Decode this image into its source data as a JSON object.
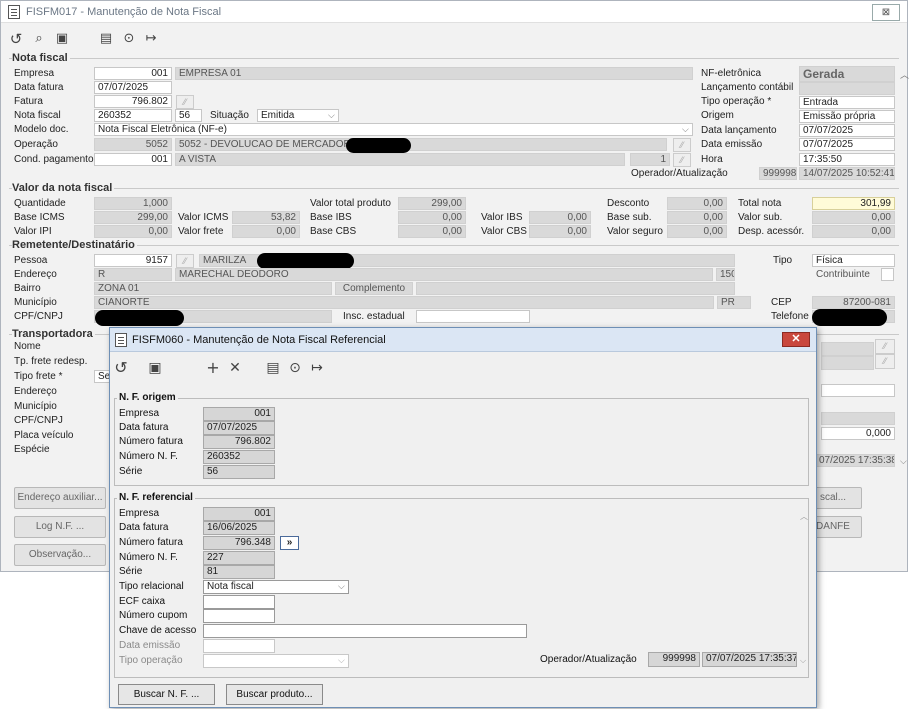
{
  "main_window": {
    "title": "FISFM017 - Manutenção de Nota Fiscal",
    "toolbar": {
      "refresh": "↺",
      "search": "🔍",
      "save": "🖫",
      "calendar": "📅",
      "help": "?",
      "exit": "↦"
    },
    "nota_fiscal": {
      "section": "Nota fiscal",
      "empresa_label": "Empresa",
      "empresa_code": "001",
      "empresa_name": "EMPRESA 01",
      "data_fatura_label": "Data fatura",
      "data_fatura": "07/07/2025",
      "fatura_label": "Fatura",
      "fatura": "796.802",
      "nota_fiscal_label": "Nota fiscal",
      "nota_fiscal": "260352",
      "serie": "56",
      "situacao_label": "Situação",
      "situacao": "Emitida",
      "modelo_label": "Modelo doc.",
      "modelo": "Nota Fiscal Eletrônica (NF-e)",
      "operacao_label": "Operação",
      "operacao_code": "5052",
      "operacao_desc": "5052 - DEVOLUCAO DE MERCADORIA",
      "cond_label": "Cond. pagamento",
      "cond_code": "001",
      "cond_desc": "A VISTA",
      "cond_parcelas": "1",
      "nfe_label": "NF-eletrônica",
      "nfe_status": "Gerada",
      "lanc_contabil_label": "Lançamento contábil",
      "tipo_op_label": "Tipo operação *",
      "tipo_op": "Entrada",
      "origem_label": "Origem",
      "origem": "Emissão própria",
      "data_lanc_label": "Data lançamento",
      "data_lanc": "07/07/2025",
      "data_emissao_label": "Data emissão",
      "data_emissao": "07/07/2025",
      "hora_label": "Hora",
      "hora": "17:35:50",
      "operador_label": "Operador/Atualização",
      "operador": "999998",
      "atualizacao": "14/07/2025 10:52:41"
    },
    "valor": {
      "section": "Valor da nota fiscal",
      "quantidade_label": "Quantidade",
      "quantidade": "1,000",
      "base_icms_label": "Base ICMS",
      "base_icms": "299,00",
      "valor_ipi_label": "Valor IPI",
      "valor_ipi": "0,00",
      "valor_icms_label": "Valor ICMS",
      "valor_icms": "53,82",
      "valor_frete_label": "Valor frete",
      "valor_frete": "0,00",
      "total_prod_label": "Valor total produto",
      "total_prod": "299,00",
      "base_ibs_label": "Base IBS",
      "base_ibs": "0,00",
      "base_cbs_label": "Base CBS",
      "base_cbs": "0,00",
      "valor_ibs_label": "Valor IBS",
      "valor_ibs": "0,00",
      "valor_cbs_label": "Valor CBS",
      "valor_cbs": "0,00",
      "desconto_label": "Desconto",
      "desconto": "0,00",
      "base_sub_label": "Base sub.",
      "base_sub": "0,00",
      "valor_seguro_label": "Valor seguro",
      "valor_seguro": "0,00",
      "total_nota_label": "Total nota",
      "total_nota": "301,99",
      "valor_sub_label": "Valor sub.",
      "valor_sub": "0,00",
      "desp_label": "Desp. acessór.",
      "desp": "0,00"
    },
    "remetente": {
      "section": "Remetente/Destinatário",
      "pessoa_label": "Pessoa",
      "pessoa_code": "9157",
      "pessoa_name": "MARILZA",
      "endereco_label": "Endereço",
      "endereco_tipo": "R",
      "endereco": "MARECHAL DEODORO",
      "numero": "150",
      "bairro_label": "Bairro",
      "bairro": "ZONA 01",
      "complemento_label": "Complemento",
      "municipio_label": "Município",
      "municipio": "CIANORTE",
      "uf": "PR",
      "cpf_label": "CPF/CNPJ",
      "insc_label": "Insc. estadual",
      "tipo_label": "Tipo",
      "tipo": "Física",
      "contribuinte_label": "Contribuinte",
      "cep_label": "CEP",
      "cep": "87200-081",
      "telefone_label": "Telefone"
    },
    "transportadora": {
      "section": "Transportadora",
      "nome_label": "Nome",
      "tp_frete_label": "Tp. frete redesp.",
      "tipo_frete_label": "Tipo frete *",
      "tipo_frete": "Se",
      "endereco_label": "Endereço",
      "municipio_label": "Município",
      "cpf_label": "CPF/CNPJ",
      "placa_label": "Placa veículo",
      "especie_label": "Espécie",
      "peso": "0,000",
      "atualizacao": "07/2025 17:35:38"
    },
    "buttons": {
      "endereco_aux": "Endereço auxiliar...",
      "log": "Log N.F. ...",
      "observacao": "Observação...",
      "fiscal": "scal...",
      "danfe": "DANFE"
    }
  },
  "dialog": {
    "title": "FISFM060 - Manutenção de Nota Fiscal Referencial",
    "close": "✕",
    "toolbar": {
      "refresh": "↺",
      "save": "🖫",
      "add": "+",
      "remove": "✕",
      "calendar": "📅",
      "help": "?",
      "exit": "↦"
    },
    "origem": {
      "section": "N. F. origem",
      "empresa_label": "Empresa",
      "empresa": "001",
      "data_fatura_label": "Data fatura",
      "data_fatura": "07/07/2025",
      "numero_fatura_label": "Número fatura",
      "numero_fatura": "796.802",
      "numero_nf_label": "Número N. F.",
      "numero_nf": "260352",
      "serie_label": "Série",
      "serie": "56"
    },
    "referencial": {
      "section": "N. F. referencial",
      "empresa_label": "Empresa",
      "empresa": "001",
      "data_fatura_label": "Data fatura",
      "data_fatura": "16/06/2025",
      "numero_fatura_label": "Número fatura",
      "numero_fatura": "796.348",
      "numero_nf_label": "Número N. F.",
      "numero_nf": "227",
      "serie_label": "Série",
      "serie": "81",
      "tipo_rel_label": "Tipo relacional",
      "tipo_rel": "Nota fiscal",
      "ecf_label": "ECF caixa",
      "cupom_label": "Número cupom",
      "chave_label": "Chave de acesso",
      "data_emissao_label": "Data emissão",
      "tipo_op_label": "Tipo operação",
      "operador_label": "Operador/Atualização",
      "operador": "999998",
      "atualizacao": "07/07/2025 17:35:37"
    },
    "buttons": {
      "buscar_nf": "Buscar N. F. ...",
      "buscar_produto": "Buscar produto..."
    }
  }
}
